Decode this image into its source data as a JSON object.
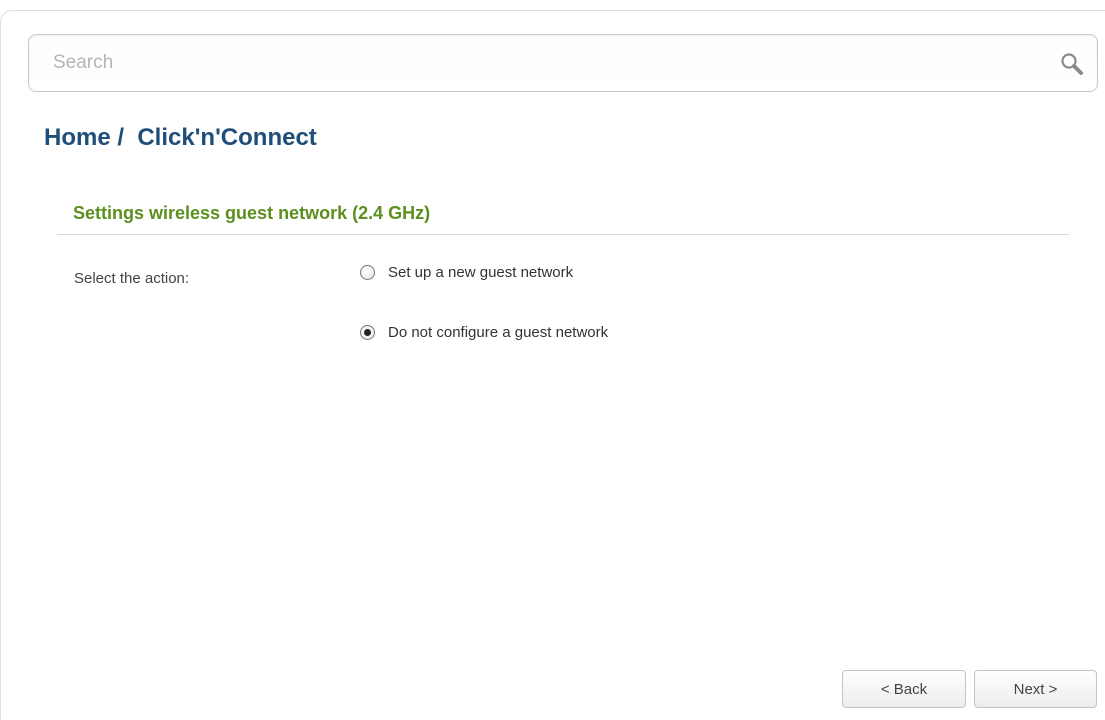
{
  "search": {
    "placeholder": "Search",
    "value": ""
  },
  "breadcrumb": {
    "text": "Home /  Click'n'Connect"
  },
  "section": {
    "title": "Settings wireless guest network (2.4 GHz)"
  },
  "form": {
    "action_label": "Select the action:",
    "options": [
      {
        "label": "Set up a new guest network",
        "checked": false
      },
      {
        "label": "Do not configure a guest network",
        "checked": true
      }
    ]
  },
  "buttons": {
    "back": "< Back",
    "next": "Next >"
  },
  "colors": {
    "breadcrumb": "#1f4e7b",
    "section_title": "#5b8f1e"
  }
}
